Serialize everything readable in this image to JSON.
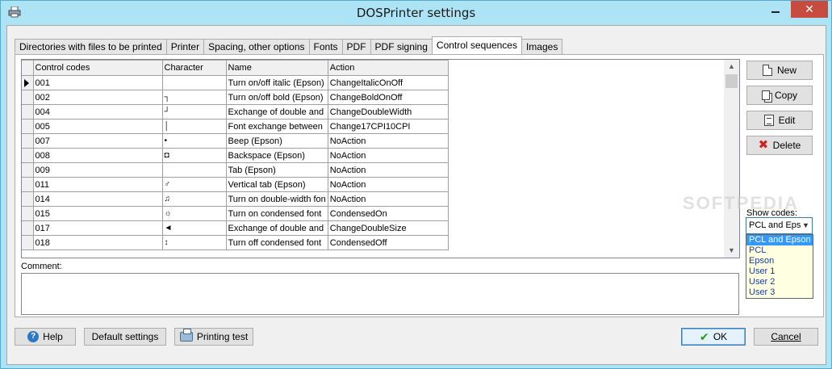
{
  "window": {
    "title": "DOSPrinter settings",
    "close_glyph": "✕"
  },
  "tabs": [
    {
      "label": "Directories with files to be printed",
      "active": false
    },
    {
      "label": "Printer",
      "active": false
    },
    {
      "label": "Spacing, other options",
      "active": false
    },
    {
      "label": "Fonts",
      "active": false
    },
    {
      "label": "PDF",
      "active": false
    },
    {
      "label": "PDF signing",
      "active": false
    },
    {
      "label": "Control sequences",
      "active": true
    },
    {
      "label": "Images",
      "active": false
    }
  ],
  "grid": {
    "columns": [
      "Control codes",
      "Character",
      "Name",
      "Action"
    ],
    "selected_row": 0,
    "rows": [
      {
        "code": "001",
        "char": "",
        "name": "Turn on/off italic (Epson)",
        "action": "ChangeItalicOnOff"
      },
      {
        "code": "002",
        "char": "┐",
        "name": "Turn on/off bold (Epson)",
        "action": "ChangeBoldOnOff"
      },
      {
        "code": "004",
        "char": "┘",
        "name": "Exchange of double and",
        "action": "ChangeDoubleWidth"
      },
      {
        "code": "005",
        "char": "│",
        "name": "Font exchange between",
        "action": "Change17CPI10CPI"
      },
      {
        "code": "007",
        "char": "•",
        "name": "Beep (Epson)",
        "action": "NoAction"
      },
      {
        "code": "008",
        "char": "◘",
        "name": "Backspace (Epson)",
        "action": "NoAction"
      },
      {
        "code": "009",
        "char": "",
        "name": "Tab (Epson)",
        "action": "NoAction"
      },
      {
        "code": "011",
        "char": "♂",
        "name": "Vertical tab (Epson)",
        "action": "NoAction"
      },
      {
        "code": "014",
        "char": "♫",
        "name": "Turn on double-width fon",
        "action": "NoAction"
      },
      {
        "code": "015",
        "char": "☼",
        "name": "Turn on condensed font",
        "action": "CondensedOn"
      },
      {
        "code": "017",
        "char": "◄",
        "name": "Exchange of double and",
        "action": "ChangeDoubleSize"
      },
      {
        "code": "018",
        "char": "↕",
        "name": "Turn off condensed font",
        "action": "CondensedOff"
      }
    ]
  },
  "side_buttons": {
    "new": "New",
    "copy": "Copy",
    "edit": "Edit",
    "delete": "Delete"
  },
  "show_codes": {
    "label": "Show codes:",
    "selected_display": "PCL and Eps",
    "options": [
      "PCL and Epson",
      "PCL",
      "Epson",
      "User 1",
      "User 2",
      "User 3"
    ],
    "highlighted_index": 0
  },
  "comment": {
    "label": "Comment:",
    "value": ""
  },
  "footer": {
    "help": "Help",
    "default_settings": "Default settings",
    "printing_test": "Printing test",
    "ok": "OK",
    "cancel": "Cancel"
  },
  "watermark": "SOFTPEDIA"
}
